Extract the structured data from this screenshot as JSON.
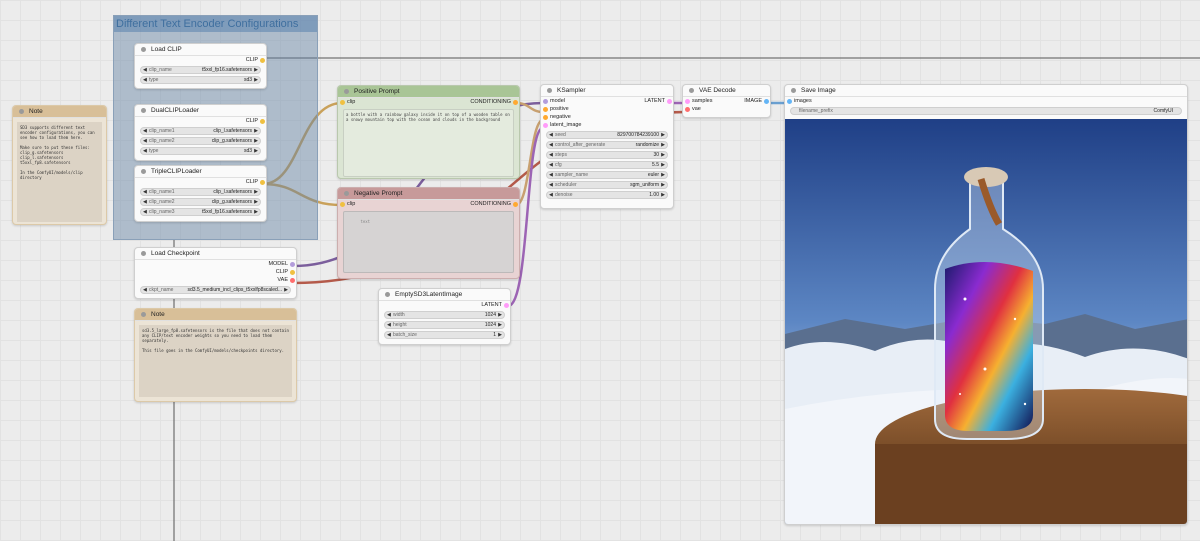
{
  "group": {
    "title": "Different Text Encoder Configurations"
  },
  "notes": [
    {
      "title": "Note",
      "text": "SD3 supports different text encoder configurations, you can see how to load them here.\n\nMake sure to put these files:\nclip_g.safetensors\nclip_l.safetensors\nt5xxl_fp8.safetensors\n\nIn the ComfyUI/models/clip directory"
    },
    {
      "title": "Note",
      "text": "sd3.5_large_fp8.safetensors is the file that does not contain any CLIP/text encoder weights so you need to load them separately.\n\nThis file goes in the ComfyUI/models/checkpoints directory."
    }
  ],
  "load_clip": {
    "title": "Load CLIP",
    "output": "CLIP",
    "widgets": [
      {
        "label": "clip_name",
        "value": "t5xxl_fp16.safetensors"
      },
      {
        "label": "type",
        "value": "sd3"
      }
    ]
  },
  "dual_clip": {
    "title": "DualCLIPLoader",
    "output": "CLIP",
    "widgets": [
      {
        "label": "clip_name1",
        "value": "clip_l.safetensors"
      },
      {
        "label": "clip_name2",
        "value": "clip_g.safetensors"
      },
      {
        "label": "type",
        "value": "sd3"
      }
    ]
  },
  "triple_clip": {
    "title": "TripleCLIPLoader",
    "output": "CLIP",
    "widgets": [
      {
        "label": "clip_name1",
        "value": "clip_l.safetensors"
      },
      {
        "label": "clip_name2",
        "value": "clip_g.safetensors"
      },
      {
        "label": "clip_name3",
        "value": "t5xxl_fp16.safetensors"
      }
    ]
  },
  "checkpoint": {
    "title": "Load Checkpoint",
    "outputs": [
      "MODEL",
      "CLIP",
      "VAE"
    ],
    "widgets": [
      {
        "label": "ckpt_name",
        "value": "sd3.5_medium_incl_clips_t5xxlfp8scaled..."
      }
    ]
  },
  "positive": {
    "title": "Positive Prompt",
    "input": "clip",
    "output": "CONDITIONING",
    "text": "a bottle with a rainbow galaxy inside it on top of a wooden table on a snowy mountain top with the ocean and clouds in the background"
  },
  "negative": {
    "title": "Negative Prompt",
    "input": "clip",
    "output": "CONDITIONING",
    "placeholder": "text"
  },
  "latent": {
    "title": "EmptySD3LatentImage",
    "output": "LATENT",
    "widgets": [
      {
        "label": "width",
        "value": "1024"
      },
      {
        "label": "height",
        "value": "1024"
      },
      {
        "label": "batch_size",
        "value": "1"
      }
    ]
  },
  "ksampler": {
    "title": "KSampler",
    "inputs": [
      "model",
      "positive",
      "negative",
      "latent_image"
    ],
    "output": "LATENT",
    "widgets": [
      {
        "label": "seed",
        "value": "829700784239100"
      },
      {
        "label": "control_after_generate",
        "value": "randomize"
      },
      {
        "label": "steps",
        "value": "30"
      },
      {
        "label": "cfg",
        "value": "5.5"
      },
      {
        "label": "sampler_name",
        "value": "euler"
      },
      {
        "label": "scheduler",
        "value": "sgm_uniform"
      },
      {
        "label": "denoise",
        "value": "1.00"
      }
    ]
  },
  "vae_decode": {
    "title": "VAE Decode",
    "inputs": [
      "samples",
      "vae"
    ],
    "output": "IMAGE"
  },
  "save_image": {
    "title": "Save Image",
    "input": "images",
    "widgets": [
      {
        "label": "filename_prefix",
        "value": "ComfyUI"
      }
    ]
  },
  "colors": {
    "clip": "#f0c040",
    "model": "#b39ddb",
    "vae": "#ff6e6e",
    "conditioning": "#ffa931",
    "latent": "#ff9cf9",
    "image": "#64b5f6",
    "wire_clip": "#c9a15a",
    "wire_model": "#7b5e9c",
    "wire_vae": "#b45a4a",
    "wire_cond": "#c8a070",
    "wire_latent": "#9c64b4",
    "wire_image": "#6a9fd0"
  }
}
